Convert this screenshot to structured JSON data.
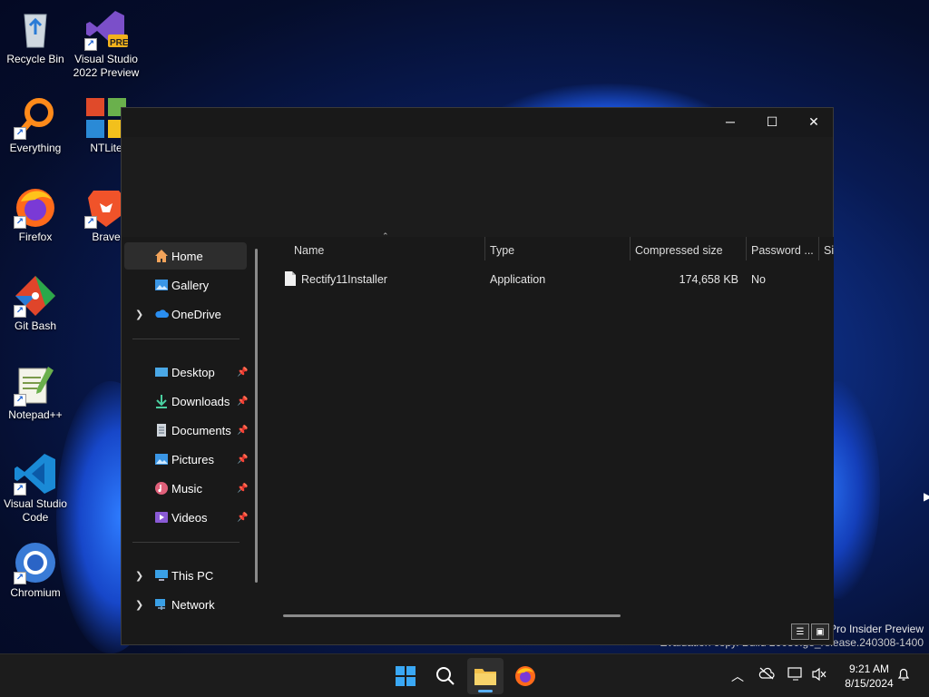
{
  "desktop": {
    "icons": [
      {
        "label": "Recycle Bin"
      },
      {
        "label": "Visual Studio\n2022 Preview",
        "badge": "PRE"
      },
      {
        "label": "Everything"
      },
      {
        "label": "NTLite"
      },
      {
        "label": "Firefox"
      },
      {
        "label": "Brave"
      },
      {
        "label": "Git Bash"
      },
      {
        "label": "Notepad++"
      },
      {
        "label": "Visual Studio\nCode"
      },
      {
        "label": "Chromium"
      }
    ],
    "watermark_line1": "Pro Insider Preview",
    "watermark_line2": "Evaluation copy. Build 26080.ge_release.240308-1400"
  },
  "window": {
    "controls": {
      "minimize": "─",
      "maximize": "☐",
      "close": "✕"
    },
    "nav": {
      "home": "Home",
      "gallery": "Gallery",
      "onedrive": "OneDrive",
      "desktop": "Desktop",
      "downloads": "Downloads",
      "documents": "Documents",
      "pictures": "Pictures",
      "music": "Music",
      "videos": "Videos",
      "thispc": "This PC",
      "network": "Network"
    },
    "columns": {
      "name": "Name",
      "type": "Type",
      "compressed_size": "Compressed size",
      "password": "Password ...",
      "size": "Si"
    },
    "files": [
      {
        "name": "Rectify11Installer",
        "type": "Application",
        "compressed_size": "174,658 KB",
        "password": "No"
      }
    ]
  },
  "taskbar": {
    "time": "9:21 AM",
    "date": "8/15/2024"
  },
  "colors": {
    "accent": "#5ab0f5",
    "window_bg": "#191919",
    "taskbar_bg": "#1c1c1c"
  }
}
